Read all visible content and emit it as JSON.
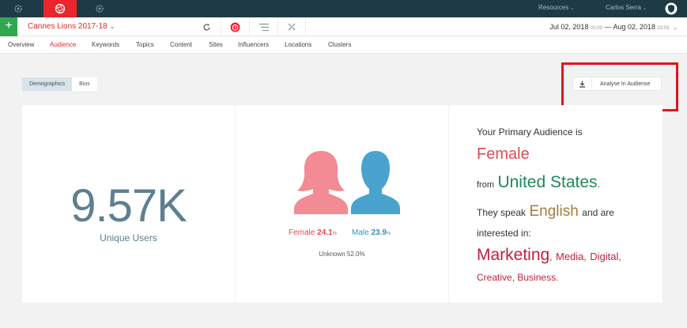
{
  "colors": {
    "topbar": "#1e3a47",
    "accent_red": "#e8262b",
    "green": "#31a84f",
    "female": "#f28b93",
    "male": "#4aa3cf",
    "number_blue": "#5e7f8e"
  },
  "topbar": {
    "icons": [
      "gear-icon",
      "aperture-icon",
      "gear-icon"
    ],
    "resources_label": "Resources",
    "user_label": "Carlos Serra"
  },
  "subbar": {
    "add_label": "+",
    "project_name": "Cannes Lions 2017-18",
    "date_start": "Jul 02, 2018",
    "time_start": "00:00",
    "date_sep": "—",
    "date_end": "Aug 02, 2018",
    "time_end": "23:59"
  },
  "tabs": [
    {
      "label": "Overview"
    },
    {
      "label": "Audience"
    },
    {
      "label": "Keywords"
    },
    {
      "label": "Topics"
    },
    {
      "label": "Content"
    },
    {
      "label": "Sites"
    },
    {
      "label": "Influencers"
    },
    {
      "label": "Locations"
    },
    {
      "label": "Clusters"
    }
  ],
  "active_tab": "Audience",
  "segment": {
    "demographics": "Demographics",
    "bios": "Bios"
  },
  "analyse_label": "Analyse In Audiense",
  "users": {
    "value": "9.57K",
    "label": "Unique Users"
  },
  "gender": {
    "female_label": "Female",
    "female_value": "24.1",
    "male_label": "Male",
    "male_value": "23.9",
    "pct": "%",
    "unknown": "Unknown 52.0%"
  },
  "audience": {
    "intro": "Your Primary Audience is",
    "gender": "Female",
    "from": "from",
    "country": "United States",
    "period": ".",
    "speak": "They speak",
    "language": "English",
    "and_are": "and are",
    "interested": "interested in:",
    "interest_1": "Marketing",
    "interest_2": "Media",
    "interest_3": "Digital",
    "interest_4": "Creative",
    "interest_5": "Business",
    "comma": ",",
    "end": "."
  }
}
